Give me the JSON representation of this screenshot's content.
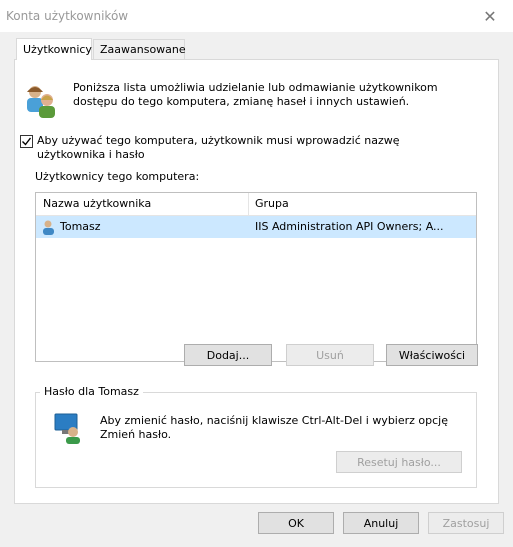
{
  "window": {
    "title": "Konta użytkowników"
  },
  "tabs": [
    {
      "label": "Użytkownicy"
    },
    {
      "label": "Zaawansowane"
    }
  ],
  "intro_text": "Poniższa lista umożliwia udzielanie lub odmawianie użytkownikom dostępu do tego komputera, zmianę haseł i innych ustawień.",
  "checkbox": {
    "checked": true,
    "label_line1": "Aby używać tego komputera, użytkownik musi wprowadzić nazwę",
    "label_line2": "użytkownika i hasło"
  },
  "users_label": "Użytkownicy tego komputera:",
  "table": {
    "columns": [
      "Nazwa użytkownika",
      "Grupa"
    ],
    "rows": [
      {
        "name": "Tomasz",
        "group": "IIS Administration API Owners; A..."
      }
    ]
  },
  "buttons": {
    "add": "Dodaj...",
    "remove": "Usuń",
    "properties": "Właściwości"
  },
  "password_group": {
    "label": "Hasło dla Tomasz",
    "text": "Aby zmienić hasło, naciśnij klawisze Ctrl-Alt-Del i wybierz opcję Zmień hasło.",
    "reset_button": "Resetuj hasło..."
  },
  "footer": {
    "ok": "OK",
    "cancel": "Anuluj",
    "apply": "Zastosuj"
  },
  "colors": {
    "selection": "#cce8ff",
    "disabled_text": "#a0a0a0"
  }
}
